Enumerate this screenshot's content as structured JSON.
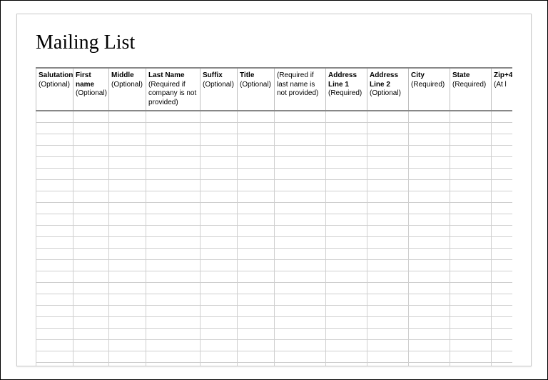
{
  "title": "Mailing List",
  "columns": [
    {
      "label": "Salutation",
      "sub": "(Optional)",
      "cls": "c-salutation"
    },
    {
      "label": "First name",
      "sub": "(Optional)",
      "cls": "c-first"
    },
    {
      "label": "Middle",
      "sub": "(Optional)",
      "cls": "c-middle"
    },
    {
      "label": "Last Name",
      "sub": "(Required if company is not provided)",
      "cls": "c-last"
    },
    {
      "label": "Suffix",
      "sub": "(Optional)",
      "cls": "c-suffix"
    },
    {
      "label": "Title",
      "sub": "(Optional)",
      "cls": "c-title"
    },
    {
      "label": "",
      "sub": "(Required if last name is not provided)",
      "cls": "c-company"
    },
    {
      "label": "Address Line 1",
      "sub": "(Required)",
      "cls": "c-addr1"
    },
    {
      "label": "Address Line 2",
      "sub": "(Optional)",
      "cls": "c-addr2"
    },
    {
      "label": "City",
      "sub": "(Required)",
      "cls": "c-city"
    },
    {
      "label": "State",
      "sub": "(Required)",
      "cls": "c-state"
    },
    {
      "label": "Zip+4",
      "sub": "(At l",
      "cls": "c-zip"
    }
  ],
  "row_count": 23
}
